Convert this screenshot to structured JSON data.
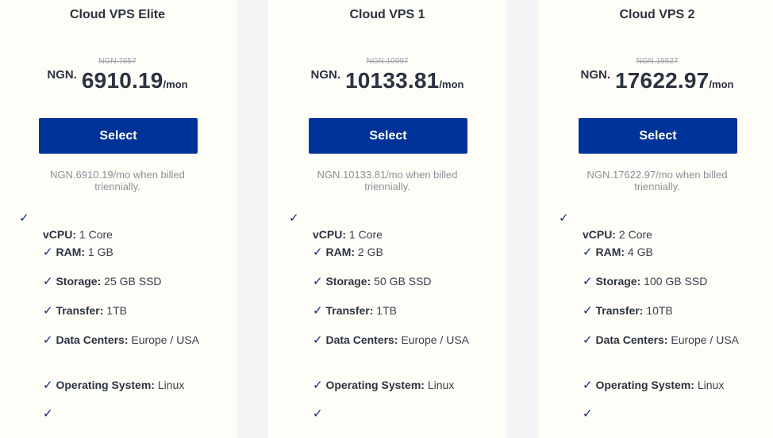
{
  "plans": [
    {
      "title": "Cloud VPS Elite",
      "old_price": "NGN.7657",
      "currency": "NGN.",
      "price": "6910.19",
      "period": "/mon",
      "button_label": "Select",
      "billing_note": "NGN.6910.19/mo when billed triennially.",
      "features": {
        "vcpu_label": "vCPU:",
        "vcpu_value": "1 Core",
        "ram_label": "RAM:",
        "ram_value": "1 GB",
        "storage_label": "Storage:",
        "storage_value": "25 GB SSD",
        "transfer_label": "Transfer:",
        "transfer_value": "1TB",
        "dc_label": "Data Centers:",
        "dc_value": "Europe / USA",
        "os_label": "Operating System:",
        "os_value": "Linux"
      }
    },
    {
      "title": "Cloud VPS 1",
      "old_price": "NGN.10997",
      "currency": "NGN.",
      "price": "10133.81",
      "period": "/mon",
      "button_label": "Select",
      "billing_note": "NGN.10133.81/mo when billed triennially.",
      "features": {
        "vcpu_label": "vCPU:",
        "vcpu_value": "1 Core",
        "ram_label": "RAM:",
        "ram_value": "2 GB",
        "storage_label": "Storage:",
        "storage_value": "50 GB SSD",
        "transfer_label": "Transfer:",
        "transfer_value": "1TB",
        "dc_label": "Data Centers:",
        "dc_value": "Europe / USA",
        "os_label": "Operating System:",
        "os_value": "Linux"
      }
    },
    {
      "title": "Cloud VPS 2",
      "old_price": "NGN.19527",
      "currency": "NGN.",
      "price": "17622.97",
      "period": "/mon",
      "button_label": "Select",
      "billing_note": "NGN.17622.97/mo when billed triennially.",
      "features": {
        "vcpu_label": "vCPU:",
        "vcpu_value": "2 Core",
        "ram_label": "RAM:",
        "ram_value": "4 GB",
        "storage_label": "Storage:",
        "storage_value": "100 GB SSD",
        "transfer_label": "Transfer:",
        "transfer_value": "10TB",
        "dc_label": "Data Centers:",
        "dc_value": "Europe / USA",
        "os_label": "Operating System:",
        "os_value": "Linux"
      }
    }
  ],
  "check_glyph": "✓",
  "colors": {
    "button_bg": "#003399",
    "check": "#0a2a7a",
    "card_bg": "#fffdf8"
  }
}
